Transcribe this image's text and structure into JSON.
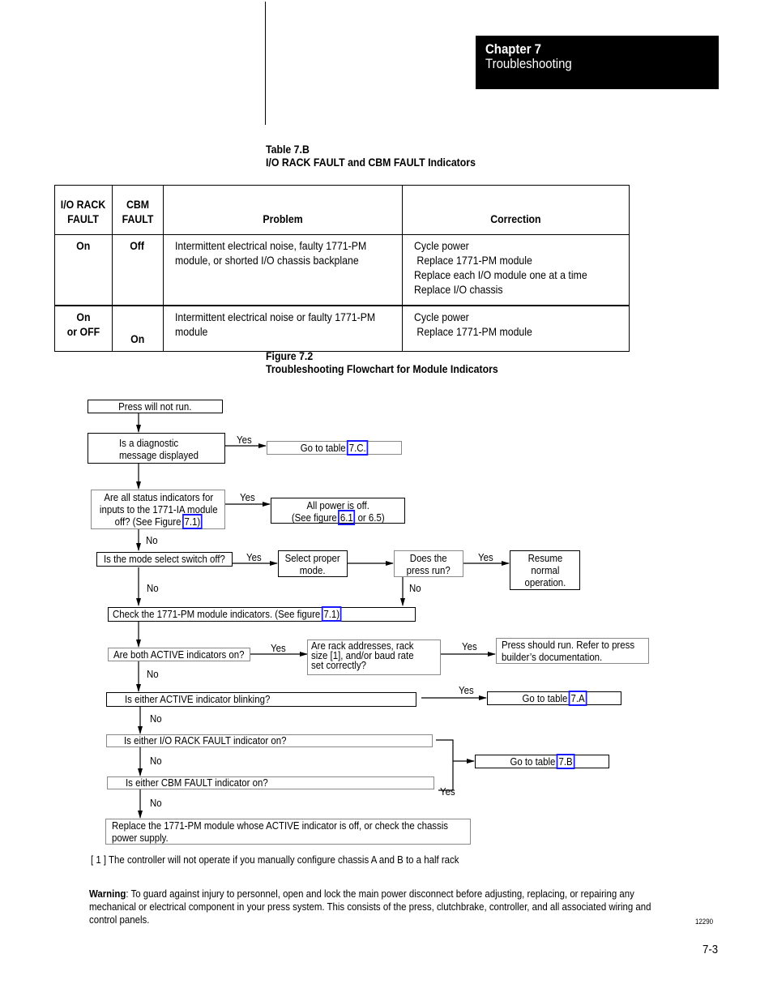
{
  "header": {
    "chapter_number": "Chapter 7",
    "chapter_title": "Troubleshooting"
  },
  "table": {
    "caption_number": "Table 7.B",
    "caption_title": "I/O RACK FAULT and CBM FAULT Indicators",
    "columns": [
      "I/O RACK\nFAULT",
      "CBM\nFAULT",
      "Problem",
      "Correction"
    ],
    "column_lines": [
      [
        "I/O RACK",
        "FAULT"
      ],
      [
        "CBM",
        "FAULT"
      ],
      [
        "Problem"
      ],
      [
        "Correction"
      ]
    ],
    "rows": [
      {
        "io_rack_fault": [
          "On"
        ],
        "cbm_fault": "Off",
        "problem": [
          "Intermittent electrical noise, faulty 1771-PM",
          "module, or shorted I/O chassis backplane"
        ],
        "correction": [
          "Cycle power",
          " Replace 1771-PM module",
          "Replace each I/O module one at a time",
          "Replace I/O chassis"
        ]
      },
      {
        "io_rack_fault": [
          "On",
          "or OFF"
        ],
        "cbm_fault": "On",
        "problem": [
          "Intermittent electrical noise or faulty 1771-PM",
          "module"
        ],
        "correction": [
          "Cycle power",
          " Replace 1771-PM module"
        ]
      }
    ]
  },
  "figure": {
    "caption_number": "Figure 7.2",
    "caption_title": "Troubleshooting Flowchart for Module Indicators",
    "nodes": {
      "start": "Press will not run.",
      "diag_q": [
        "Is a diagnostic",
        "message displayed"
      ],
      "goto_7c_prefix": "Go to table ",
      "goto_7c_link": "7.C.",
      "status_q_l1": "Are all status indicators for",
      "status_q_l2": "inputs to the 1771-IA module",
      "status_q_l3_prefix": "off? (See Figure ",
      "status_q_l3_link": "7.1)",
      "power_off_l1": "All power is off.",
      "power_off_l2_prefix": "(See figure ",
      "power_off_l2_link": "6.1",
      "power_off_l2_suffix": " or 6.5)",
      "mode_q": "Is the mode select switch off?",
      "select_mode": [
        "Select proper",
        "mode."
      ],
      "press_run_q": [
        "Does the",
        "press run?"
      ],
      "resume": [
        "Resume",
        "normal",
        "operation."
      ],
      "check_pm_prefix": "Check the 1771-PM module indicators. (See figure ",
      "check_pm_link": "7.1)",
      "active_on_q": "Are both ACTIVE indicators on?",
      "rack_q": [
        "Are rack addresses, rack",
        "size [1], and/or baud rate",
        "set correctly?"
      ],
      "press_should_run": [
        "Press should run. Refer to press",
        "builder’s documentation."
      ],
      "active_blink_q": "Is either ACTIVE indicator blinking?",
      "goto_7a_prefix": "Go to table ",
      "goto_7a_link": "7.A",
      "io_rack_q": "Is either I/O RACK FAULT indicator on?",
      "goto_7b_prefix": "Go to table ",
      "goto_7b_link": "7.B",
      "cbm_q": "Is either CBM FAULT indicator on?",
      "replace_pm": [
        "Replace the 1771-PM module whose ACTIVE indicator is off, or check the chassis",
        "power supply."
      ]
    },
    "labels": {
      "yes": "Yes",
      "no": "No"
    },
    "link_color": "#1a1aff"
  },
  "footnote": "[ 1 ] The controller will not operate if you manually configure chassis A and B to a half rack",
  "warning": {
    "label": "Warning",
    "lines": [
      ":  To guard against injury to personnel, open and lock the main power disconnect before adjusting, replacing, or repairing any",
      "mechanical or electrical component in your press system.  This consists of the press, clutchbrake, controller, and all associated wiring and",
      "control panels."
    ]
  },
  "figure_id": "12290",
  "page_number": "7-3"
}
